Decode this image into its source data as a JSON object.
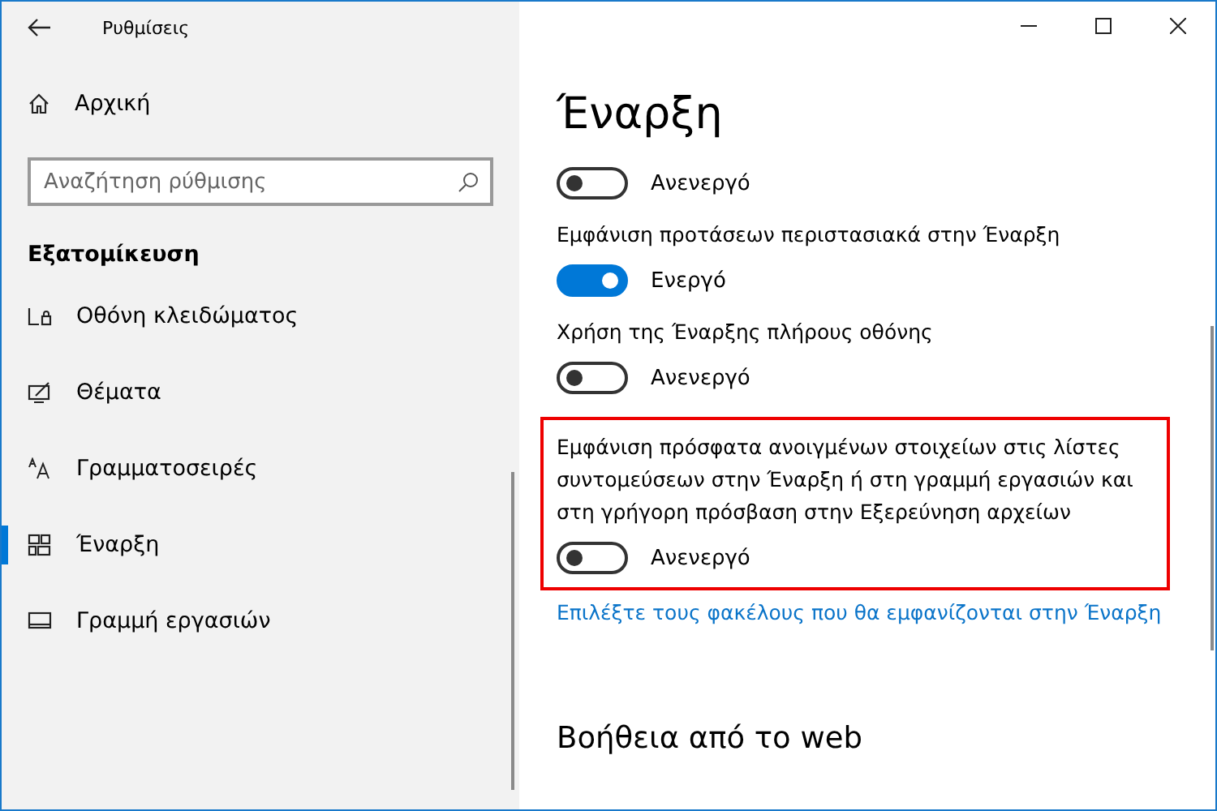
{
  "window": {
    "title": "Ρυθμίσεις"
  },
  "sidebar": {
    "home": "Αρχική",
    "search": {
      "placeholder": "Αναζήτηση ρύθμισης"
    },
    "section": "Εξατομίκευση",
    "items": [
      {
        "label": "Οθόνη κλειδώματος",
        "selected": false
      },
      {
        "label": "Θέματα",
        "selected": false
      },
      {
        "label": "Γραμματοσειρές",
        "selected": false
      },
      {
        "label": "Έναρξη",
        "selected": true
      },
      {
        "label": "Γραμμή εργασιών",
        "selected": false
      }
    ]
  },
  "page": {
    "title": "Έναρξη",
    "settings": [
      {
        "on": false,
        "state_text": "Ανενεργό",
        "highlighted": false
      },
      {
        "label": "Εμφάνιση προτάσεων περιστασιακά στην Έναρξη",
        "on": true,
        "state_text": "Ενεργό",
        "highlighted": false
      },
      {
        "label": "Χρήση της Έναρξης πλήρους οθόνης",
        "on": false,
        "state_text": "Ανενεργό",
        "highlighted": false
      },
      {
        "label": "Εμφάνιση πρόσφατα ανοιγμένων στοιχείων στις λίστες συντομεύσεων στην Έναρξη ή στη γραμμή εργασιών και στη γρήγορη πρόσβαση στην Εξερεύνηση αρχείων",
        "on": false,
        "state_text": "Ανενεργό",
        "highlighted": true
      }
    ],
    "link": "Επιλέξτε τους φακέλους που θα εμφανίζονται στην Έναρξη",
    "help_heading": "Βοήθεια από το web"
  }
}
